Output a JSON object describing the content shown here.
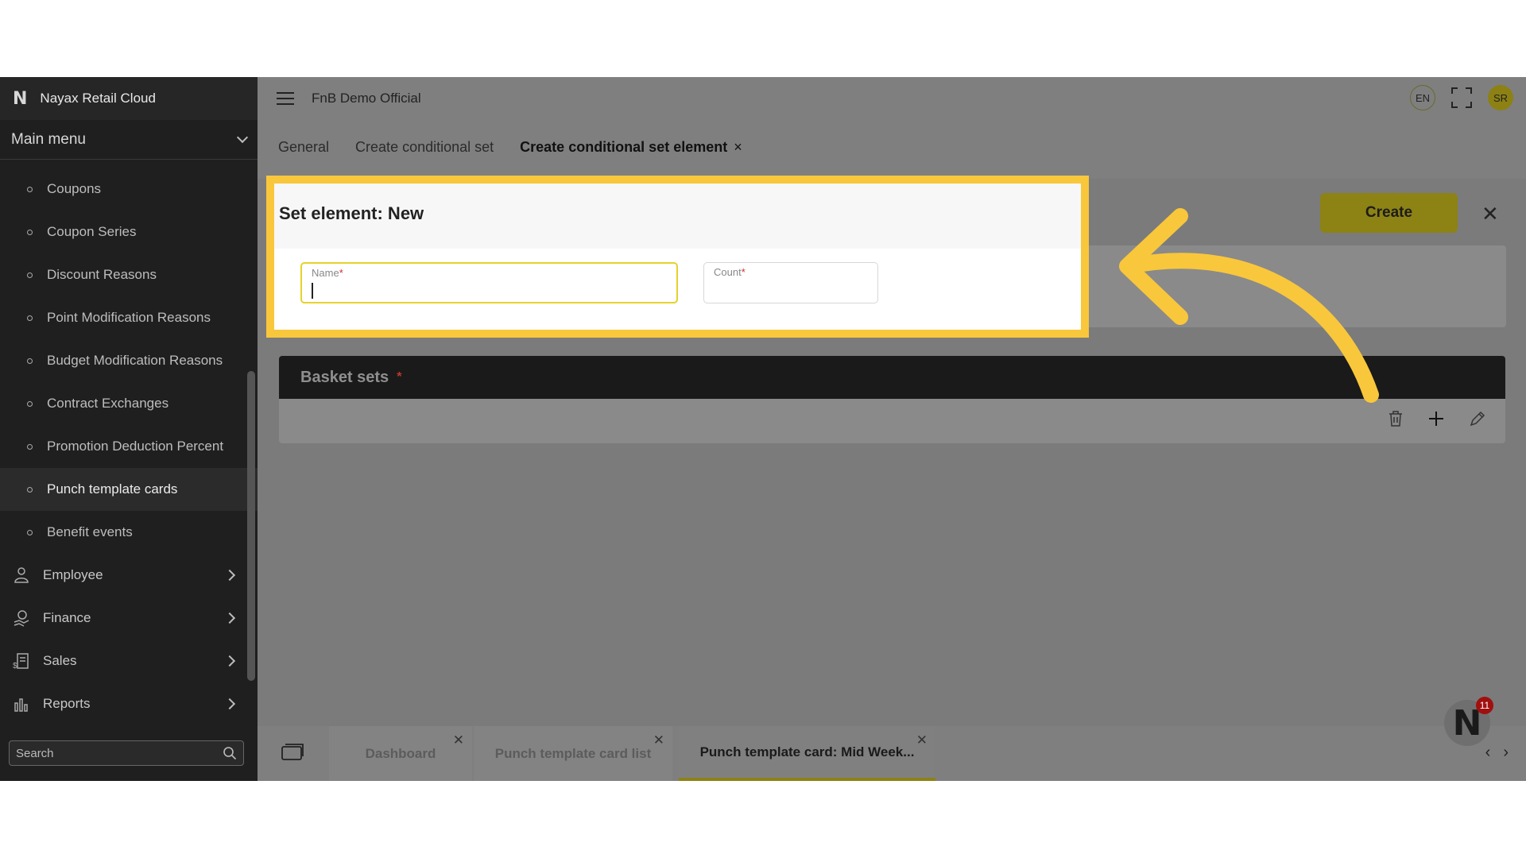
{
  "sidebar": {
    "brand": "Nayax Retail Cloud",
    "brand_logo": "N",
    "main_menu": "Main menu",
    "subitems": [
      {
        "label": "Coupons"
      },
      {
        "label": "Coupon Series"
      },
      {
        "label": "Discount Reasons"
      },
      {
        "label": "Point Modification Reasons"
      },
      {
        "label": "Budget Modification Reasons"
      },
      {
        "label": "Contract Exchanges"
      },
      {
        "label": "Promotion Deduction Percent"
      },
      {
        "label": "Punch template cards",
        "active": true
      },
      {
        "label": "Benefit events"
      }
    ],
    "groups": [
      {
        "label": "Employee",
        "icon": "employee-icon"
      },
      {
        "label": "Finance",
        "icon": "finance-icon"
      },
      {
        "label": "Sales",
        "icon": "sales-icon"
      },
      {
        "label": "Reports",
        "icon": "reports-icon"
      }
    ],
    "search_placeholder": "Search"
  },
  "topbar": {
    "company": "FnB Demo Official",
    "language": "EN",
    "avatar": "SR"
  },
  "tabs": [
    {
      "label": "General"
    },
    {
      "label": "Create conditional set"
    },
    {
      "label": "Create conditional set element",
      "active": true,
      "close": "×"
    }
  ],
  "form": {
    "title": "Set element: New",
    "name_label": "Name",
    "count_label": "Count",
    "required_mark": "*",
    "create_label": "Create",
    "close_symbol": "✕"
  },
  "basket": {
    "title": "Basket sets",
    "required_mark": "*"
  },
  "taskbar": {
    "tabs": [
      {
        "label": "Dashboard"
      },
      {
        "label": "Punch template card list"
      },
      {
        "label": "Punch template card: Mid Week...",
        "active": true
      }
    ],
    "close_symbol": "✕",
    "prev": "‹",
    "next": "›"
  },
  "notifications": {
    "logo": "N",
    "count": "11"
  },
  "colors": {
    "highlight": "#f9c73b",
    "accent": "#8d8214",
    "sidebar_bg": "#1f1f1f",
    "overlay_bg": "#7f7f7f"
  }
}
